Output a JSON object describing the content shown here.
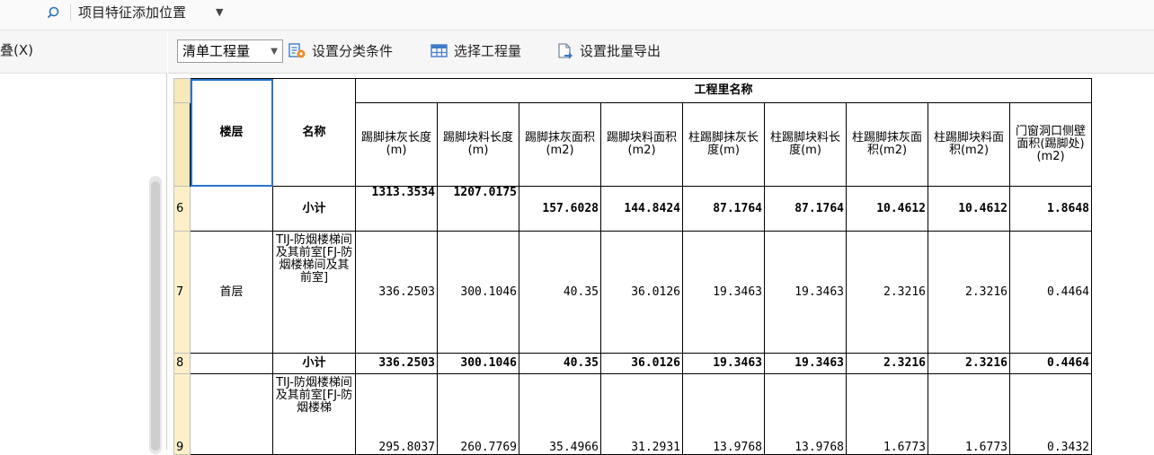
{
  "topbar": {
    "field_position_label": "项目特征添加位置"
  },
  "left_panel": {
    "title": "叠(X)"
  },
  "toolbar": {
    "quantity_select": "清单工程量",
    "set_category": "设置分类条件",
    "choose_quantity": "选择工程量",
    "batch_export": "设置批量导出"
  },
  "table": {
    "group_header": "工程里名称",
    "col_floor": "楼层",
    "col_name": "名称",
    "columns": [
      "踢脚抹灰长度(m)",
      "踢脚块料长度(m)",
      "踢脚抹灰面积(m2)",
      "踢脚块料面积(m2)",
      "柱踢脚抹灰长度(m)",
      "柱踢脚块料长度(m)",
      "柱踢脚抹灰面积(m2)",
      "柱踢脚块料面积(m2)",
      "门窗洞口侧壁面积(踢脚处)(m2)"
    ],
    "rows": [
      {
        "num": "6",
        "floor": "",
        "name": "小计",
        "subtotal": true,
        "values": [
          "1313.3534",
          "1207.0175",
          "157.6028",
          "144.8424",
          "87.1764",
          "87.1764",
          "10.4612",
          "10.4612",
          "1.8648"
        ]
      },
      {
        "num": "7",
        "floor": "首层",
        "name": "TIJ-防烟楼梯间及其前室[FJ-防烟楼梯间及其前室]",
        "subtotal": false,
        "values": [
          "336.2503",
          "300.1046",
          "40.35",
          "36.0126",
          "19.3463",
          "19.3463",
          "2.3216",
          "2.3216",
          "0.4464"
        ]
      },
      {
        "num": "8",
        "floor": "",
        "name": "小计",
        "subtotal": true,
        "values": [
          "336.2503",
          "300.1046",
          "40.35",
          "36.0126",
          "19.3463",
          "19.3463",
          "2.3216",
          "2.3216",
          "0.4464"
        ]
      },
      {
        "num": "9",
        "floor": "",
        "name": "TIJ-防烟楼梯间及其前室[FJ-防烟楼梯",
        "subtotal": false,
        "values": [
          "295.8037",
          "260.7769",
          "35.4966",
          "31.2931",
          "13.9768",
          "13.9768",
          "1.6773",
          "1.6773",
          "0.3432"
        ]
      }
    ]
  },
  "colors": {
    "selection": "#2a74c9",
    "rownum_bg": "#fdf0c8"
  }
}
